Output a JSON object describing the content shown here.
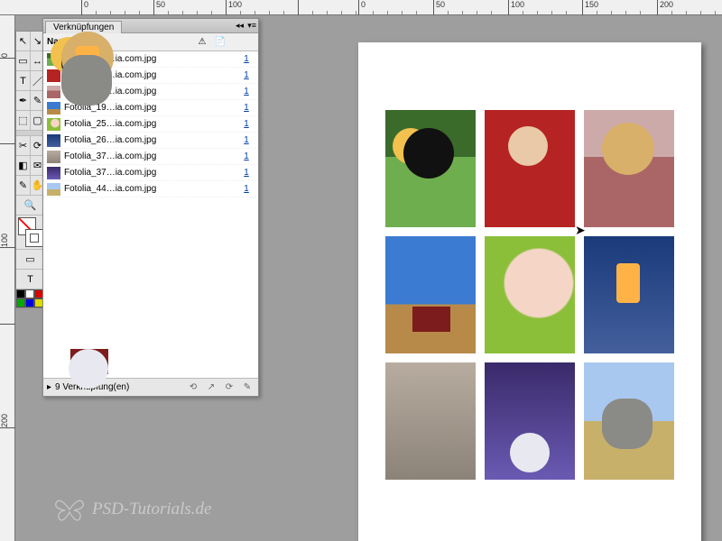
{
  "ruler": {
    "h_ticks": [
      {
        "pos": 90,
        "label": "0"
      },
      {
        "pos": 170,
        "label": "50"
      },
      {
        "pos": 250,
        "label": "100"
      },
      {
        "pos": 330,
        "label": ""
      },
      {
        "pos": 397,
        "label": "0"
      },
      {
        "pos": 480,
        "label": "50"
      },
      {
        "pos": 563,
        "label": "100"
      },
      {
        "pos": 645,
        "label": "150"
      },
      {
        "pos": 728,
        "label": "200"
      }
    ],
    "v_ticks": [
      {
        "pos": 40,
        "label": "0"
      },
      {
        "pos": 140,
        "label": ""
      },
      {
        "pos": 240,
        "label": "100"
      },
      {
        "pos": 340,
        "label": ""
      },
      {
        "pos": 440,
        "label": "200"
      }
    ]
  },
  "panel": {
    "title": "Verknüpfungen",
    "header_name": "Name",
    "warn_icon": "⚠",
    "page_icon": "📄",
    "rows": [
      {
        "file": "Fotolia_16…ia.com.jpg",
        "count": "1",
        "thumb": "img-toucan"
      },
      {
        "file": "Fotolia_17…ia.com.jpg",
        "count": "1",
        "thumb": "img-carwoman"
      },
      {
        "file": "Fotolia_17…ia.com.jpg",
        "count": "1",
        "thumb": "img-blonde"
      },
      {
        "file": "Fotolia_19…ia.com.jpg",
        "count": "1",
        "thumb": "img-tractor"
      },
      {
        "file": "Fotolia_25…ia.com.jpg",
        "count": "1",
        "thumb": "img-baby"
      },
      {
        "file": "Fotolia_26…ia.com.jpg",
        "count": "1",
        "thumb": "img-lantern"
      },
      {
        "file": "Fotolia_37…ia.com.jpg",
        "count": "1",
        "thumb": "img-rabbit"
      },
      {
        "file": "Fotolia_37…ia.com.jpg",
        "count": "1",
        "thumb": "img-drums"
      },
      {
        "file": "Fotolia_44…ia.com.jpg",
        "count": "1",
        "thumb": "img-elephant"
      }
    ],
    "status": "9 Verknüpfung(en)",
    "btn_relink": "⟲",
    "btn_goto": "↗",
    "btn_update": "⟳",
    "btn_edit": "✎"
  },
  "tools": {
    "selection": "↖",
    "direct": "↘",
    "page": "▭",
    "gap": "↔",
    "type": "T",
    "line": "／",
    "pen": "✒",
    "pencil": "✎",
    "frame": "⬚",
    "rect": "▢",
    "scissors": "✂",
    "transform": "⟳",
    "gradient": "◧",
    "note": "✉",
    "eyedrop": "✎",
    "hand": "✋",
    "zoom": "🔍"
  },
  "watermark": "PSD-Tutorials.de",
  "grid_images": [
    "img-toucan",
    "img-carwoman",
    "img-blonde",
    "img-tractor",
    "img-baby",
    "img-lantern",
    "img-rabbit",
    "img-drums",
    "img-elephant"
  ],
  "swatch_colors": [
    "#000",
    "#fff",
    "#d00",
    "#0a0",
    "#00d",
    "#dd0"
  ]
}
